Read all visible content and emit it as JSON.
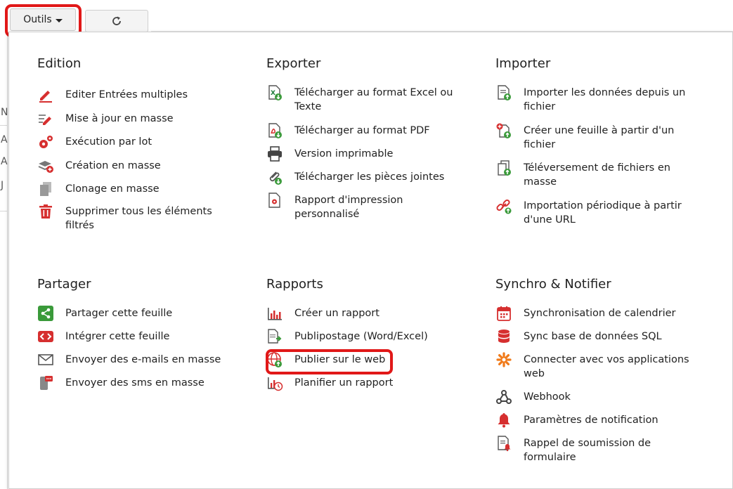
{
  "toolbar": {
    "tools_label": "Outils",
    "refresh_icon": "refresh-icon"
  },
  "background": {
    "row_letters": [
      "N",
      "A",
      "A",
      "J"
    ]
  },
  "colors": {
    "accent": "#d62f2f",
    "green": "#3a9a3a",
    "highlight": "#e11818",
    "gray_icon": "#8a8a8a"
  },
  "menu": {
    "edition": {
      "title": "Edition",
      "items": [
        {
          "label": "Editer Entrées multiples",
          "icon": "edit-pencil-icon"
        },
        {
          "label": "Mise à jour en masse",
          "icon": "mass-update-icon"
        },
        {
          "label": "Exécution par lot",
          "icon": "gears-icon"
        },
        {
          "label": "Création en masse",
          "icon": "layers-add-icon"
        },
        {
          "label": "Clonage en masse",
          "icon": "clone-icon"
        },
        {
          "label": "Supprimer tous les éléments filtrés",
          "icon": "trash-icon"
        }
      ]
    },
    "exporter": {
      "title": "Exporter",
      "items": [
        {
          "label": "Télécharger au format Excel ou Texte",
          "icon": "excel-download-icon"
        },
        {
          "label": "Télécharger au format PDF",
          "icon": "pdf-download-icon"
        },
        {
          "label": "Version imprimable",
          "icon": "printer-icon"
        },
        {
          "label": "Télécharger les pièces jointes",
          "icon": "paperclip-download-icon"
        },
        {
          "label": "Rapport d'impression personnalisé",
          "icon": "custom-print-report-icon"
        }
      ]
    },
    "importer": {
      "title": "Importer",
      "items": [
        {
          "label": "Importer les données depuis un fichier",
          "icon": "file-import-icon"
        },
        {
          "label": "Créer une feuille à partir d'un fichier",
          "icon": "sheet-from-file-icon"
        },
        {
          "label": "Téléversement de fichiers en masse",
          "icon": "files-upload-icon"
        },
        {
          "label": "Importation périodique à partir d'une URL",
          "icon": "link-import-icon"
        }
      ]
    },
    "partager": {
      "title": "Partager",
      "items": [
        {
          "label": "Partager cette feuille",
          "icon": "share-icon"
        },
        {
          "label": "Intégrer cette feuille",
          "icon": "embed-code-icon"
        },
        {
          "label": "Envoyer des e-mails en masse",
          "icon": "envelope-icon"
        },
        {
          "label": "Envoyer des sms en masse",
          "icon": "phone-sms-icon"
        }
      ]
    },
    "rapports": {
      "title": "Rapports",
      "items": [
        {
          "label": "Créer un rapport",
          "icon": "bar-chart-icon"
        },
        {
          "label": "Publipostage (Word/Excel)",
          "icon": "mail-merge-icon"
        },
        {
          "label": "Publier sur le web",
          "icon": "globe-publish-icon"
        },
        {
          "label": "Planifier un rapport",
          "icon": "schedule-report-icon"
        }
      ]
    },
    "synchro": {
      "title": "Synchro & Notifier",
      "items": [
        {
          "label": "Synchronisation de calendrier",
          "icon": "calendar-icon"
        },
        {
          "label": "Sync base de données SQL",
          "icon": "database-icon"
        },
        {
          "label": "Connecter avec vos applications web",
          "icon": "zapier-asterisk-icon"
        },
        {
          "label": "Webhook",
          "icon": "webhook-icon"
        },
        {
          "label": "Paramètres de notification",
          "icon": "bell-icon"
        },
        {
          "label": "Rappel de soumission de formulaire",
          "icon": "form-reminder-icon"
        }
      ]
    }
  }
}
